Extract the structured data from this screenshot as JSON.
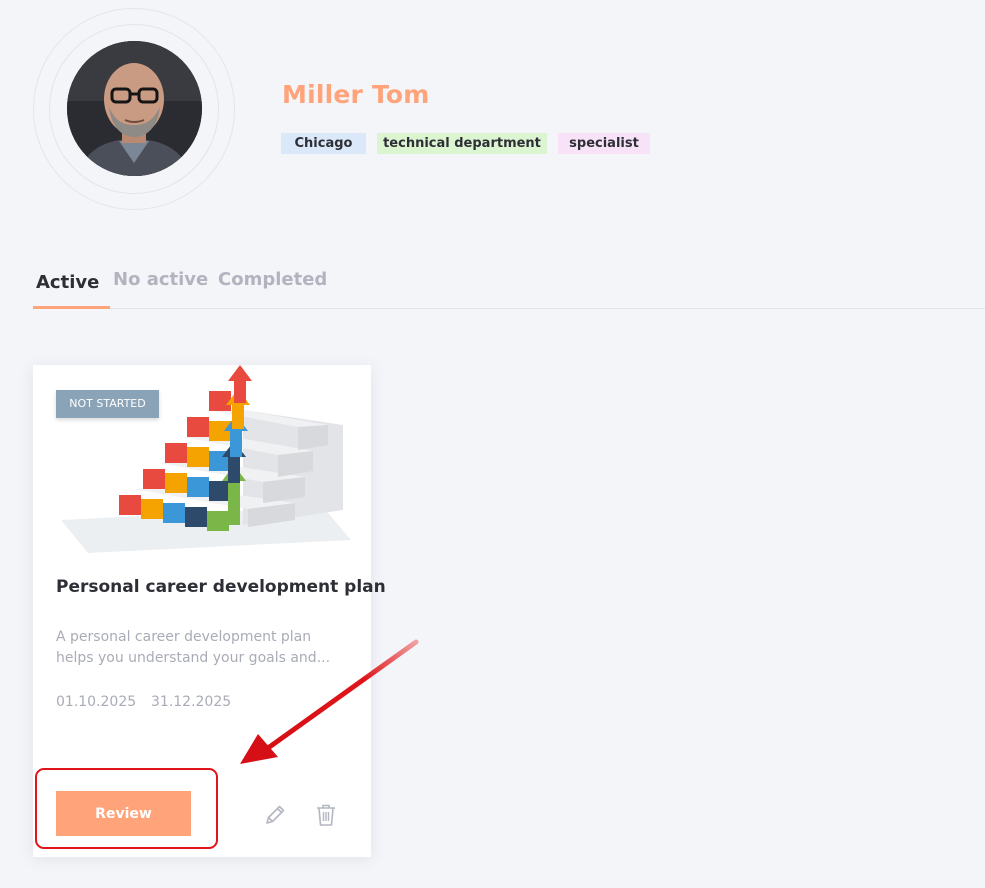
{
  "profile": {
    "name": "Miller Tom",
    "tags": {
      "city": "Chicago",
      "department": "technical department",
      "role": "specialist"
    },
    "avatar_icon": "user-photo"
  },
  "tabs": {
    "active": "Active",
    "no_active": "No active",
    "completed": "Completed",
    "selected": "Active"
  },
  "card": {
    "status": "NOT STARTED",
    "title": "Personal career development plan",
    "description": "A personal career development plan helps you understand your goals and...",
    "start_date": "01.10.2025",
    "end_date": "31.12.2025",
    "review_label": "Review",
    "edit_icon": "pencil-icon",
    "delete_icon": "trash-icon"
  },
  "colors": {
    "accent": "#ffa37a",
    "status_badge": "#8aa3b7",
    "annotation": "#e0151b"
  }
}
